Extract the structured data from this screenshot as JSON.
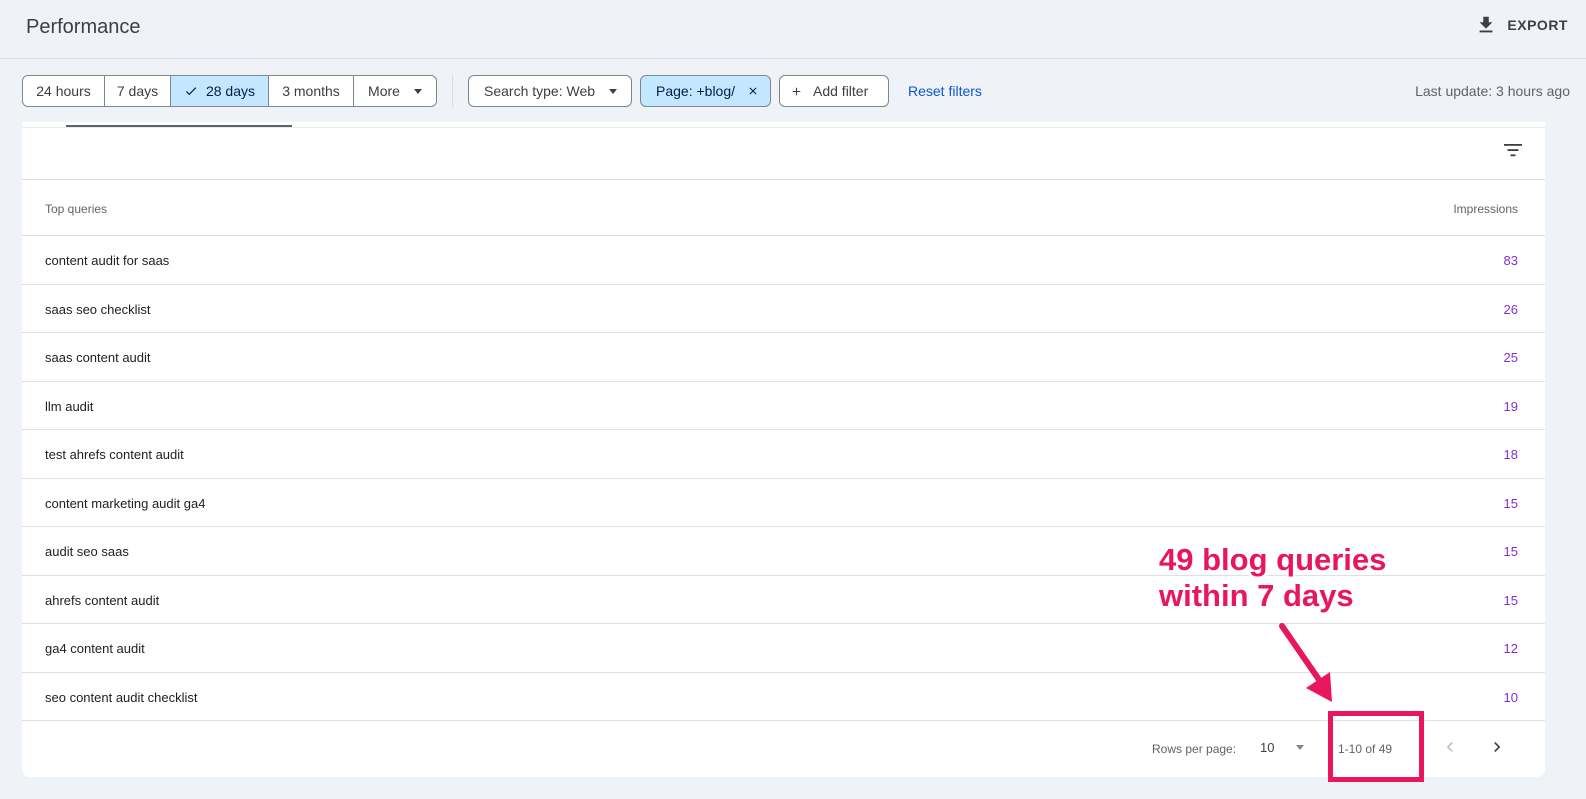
{
  "header": {
    "title": "Performance",
    "export_label": "EXPORT"
  },
  "date_range": {
    "options": [
      "24 hours",
      "7 days",
      "28 days",
      "3 months",
      "More"
    ],
    "selected": "28 days"
  },
  "filters": {
    "search_type": "Search type: Web",
    "page_filter": "Page: +blog/",
    "add_filter": "Add filter",
    "reset": "Reset filters",
    "last_update": "Last update: 3 hours ago"
  },
  "table": {
    "columns": [
      "Top queries",
      "Impressions"
    ],
    "rows": [
      {
        "query": "content audit for saas",
        "impressions": "83"
      },
      {
        "query": "saas seo checklist",
        "impressions": "26"
      },
      {
        "query": "saas content audit",
        "impressions": "25"
      },
      {
        "query": "llm audit",
        "impressions": "19"
      },
      {
        "query": "test ahrefs content audit",
        "impressions": "18"
      },
      {
        "query": "content marketing audit ga4",
        "impressions": "15"
      },
      {
        "query": "audit seo saas",
        "impressions": "15"
      },
      {
        "query": "ahrefs content audit",
        "impressions": "15"
      },
      {
        "query": "ga4 content audit",
        "impressions": "12"
      },
      {
        "query": "seo content audit checklist",
        "impressions": "10"
      }
    ]
  },
  "pagination": {
    "rows_per_page_label": "Rows per page:",
    "rows_per_page_value": "10",
    "range": "1-10 of 49"
  },
  "annotation": {
    "line1": "49 blog queries",
    "line2": "within 7 days",
    "color": "#e8175d"
  }
}
